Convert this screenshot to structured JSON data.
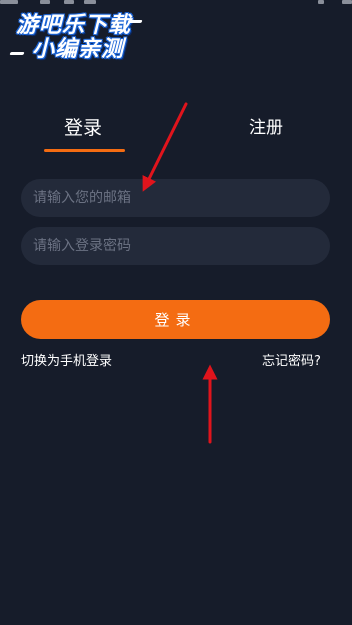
{
  "watermark": {
    "line1": "游吧乐下载",
    "line2": "小编亲测"
  },
  "tabs": [
    {
      "label": "登录",
      "active": true
    },
    {
      "label": "注册",
      "active": false
    }
  ],
  "form": {
    "email_placeholder": "请输入您的邮箱",
    "password_placeholder": "请输入登录密码",
    "submit_label": "登录"
  },
  "links": {
    "phone_login": "切换为手机登录",
    "forgot_password": "忘记密码?"
  },
  "colors": {
    "background": "#161c2a",
    "accent": "#f46c12",
    "field_bg": "#232a3a",
    "annotation_arrow": "#e0141c"
  },
  "annotations": [
    {
      "type": "arrow",
      "icon": "red-arrow-icon",
      "points_to": "email-field"
    },
    {
      "type": "arrow",
      "icon": "red-arrow-icon",
      "points_to": "login-button"
    }
  ]
}
